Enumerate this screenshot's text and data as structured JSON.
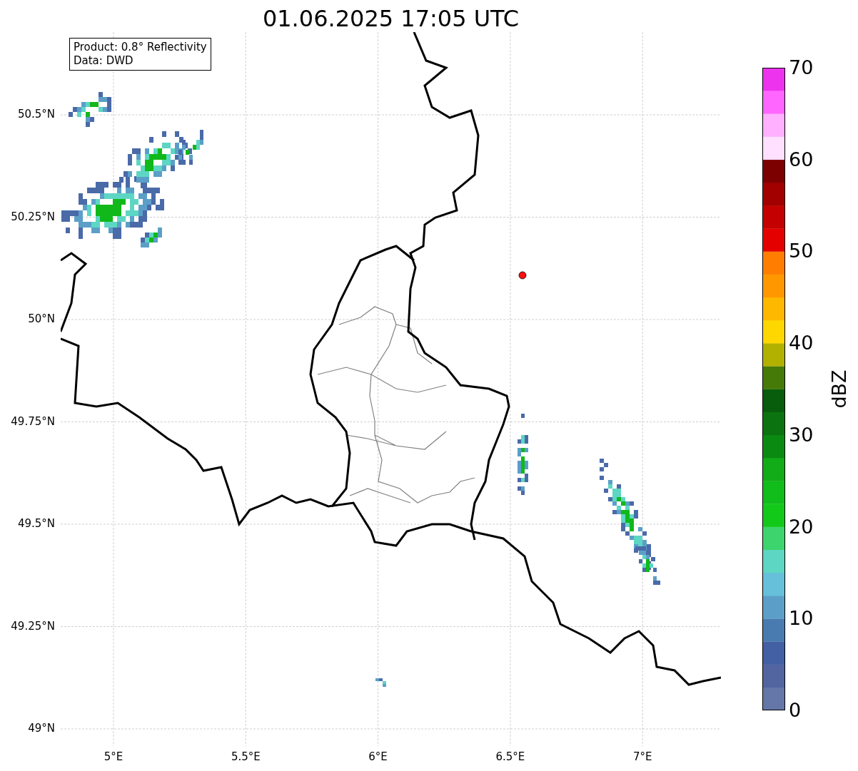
{
  "title": "01.06.2025 17:05 UTC",
  "legend": [
    "Product: 0.8° Reflectivity",
    "Data: DWD"
  ],
  "y_ticks": [
    "50.5°N",
    "50.25°N",
    "50°N",
    "49.75°N",
    "49.5°N",
    "49.25°N",
    "49°N"
  ],
  "x_ticks": [
    "5°E",
    "5.5°E",
    "6°E",
    "6.5°E",
    "7°E"
  ],
  "colorbar": {
    "label": "dBZ",
    "ticks": [
      "70",
      "60",
      "50",
      "40",
      "30",
      "20",
      "10",
      "0"
    ],
    "segments": [
      {
        "color": "#6577a8"
      },
      {
        "color": "#5265a0"
      },
      {
        "color": "#4360a4"
      },
      {
        "color": "#4a7bb0"
      },
      {
        "color": "#5b9fc8"
      },
      {
        "color": "#66c0da"
      },
      {
        "color": "#5ed6c4"
      },
      {
        "color": "#3dd46e"
      },
      {
        "color": "#12c91a"
      },
      {
        "color": "#10bd1a"
      },
      {
        "color": "#11ac17"
      },
      {
        "color": "#0b8a12"
      },
      {
        "color": "#0b7410"
      },
      {
        "color": "#085d0c"
      },
      {
        "color": "#457a09"
      },
      {
        "color": "#b2b100"
      },
      {
        "color": "#ffd700"
      },
      {
        "color": "#ffb800"
      },
      {
        "color": "#ff9800"
      },
      {
        "color": "#ff7d00"
      },
      {
        "color": "#e50000"
      },
      {
        "color": "#c40000"
      },
      {
        "color": "#a20000"
      },
      {
        "color": "#7d0000"
      },
      {
        "color": "#ffe0ff"
      },
      {
        "color": "#ffb0ff"
      },
      {
        "color": "#ff66ff"
      },
      {
        "color": "#ee33ee"
      }
    ]
  }
}
